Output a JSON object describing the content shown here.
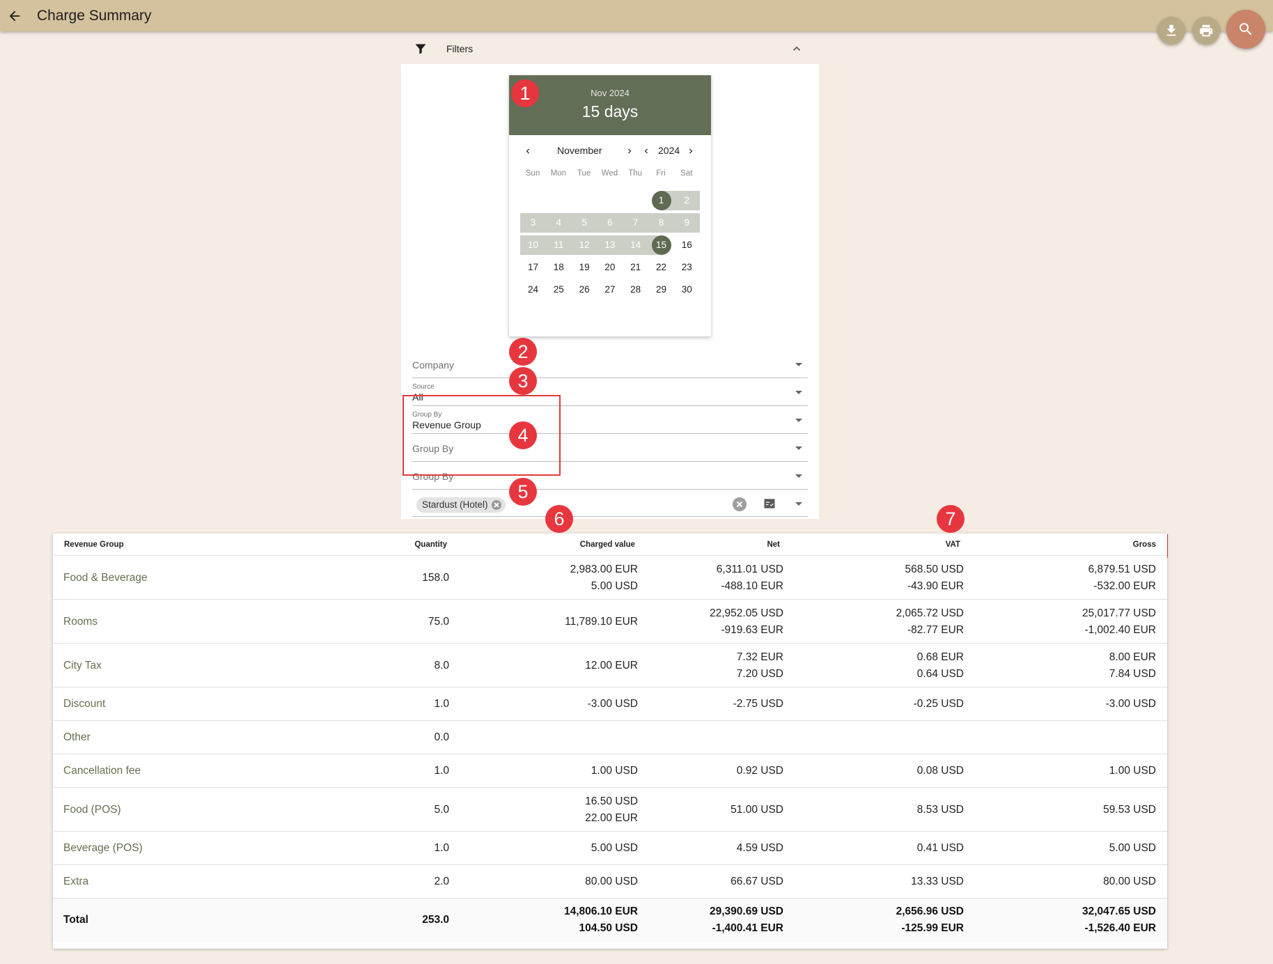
{
  "header": {
    "title": "Charge Summary",
    "icons": [
      "back-arrow-icon",
      "download-icon",
      "print-icon",
      "search-icon"
    ],
    "colors": {
      "bar": "#d3c29d",
      "search_button": "#c9846a",
      "accent": "#636e56"
    }
  },
  "filters": {
    "label": "Filters",
    "date_picker": {
      "header_month": "Nov 2024",
      "header_days": "15 days",
      "month_label": "November",
      "year_label": "2024",
      "weekdays": [
        "Sun",
        "Mon",
        "Tue",
        "Wed",
        "Thu",
        "Fri",
        "Sat"
      ],
      "weeks": [
        [
          "",
          "",
          "",
          "",
          "",
          "1",
          "2"
        ],
        [
          "3",
          "4",
          "5",
          "6",
          "7",
          "8",
          "9"
        ],
        [
          "10",
          "11",
          "12",
          "13",
          "14",
          "15",
          "16"
        ],
        [
          "17",
          "18",
          "19",
          "20",
          "21",
          "22",
          "23"
        ],
        [
          "24",
          "25",
          "26",
          "27",
          "28",
          "29",
          "30"
        ]
      ],
      "range_start": 1,
      "range_end": 15
    },
    "company": {
      "placeholder": "Company"
    },
    "source": {
      "label": "Source",
      "value": "All"
    },
    "group_by_1": {
      "label": "Group By",
      "value": "Revenue Group"
    },
    "group_by_2": {
      "placeholder": "Group By"
    },
    "group_by_3": {
      "placeholder": "Group By"
    },
    "property_chip": "Stardust (Hotel)"
  },
  "annotations": [
    "1",
    "2",
    "3",
    "4",
    "5",
    "6",
    "7"
  ],
  "table": {
    "headers": {
      "group": "Revenue Group",
      "quantity": "Quantity",
      "charged": "Charged value",
      "net": "Net",
      "vat": "VAT",
      "gross": "Gross"
    },
    "rows": [
      {
        "name": "Food & Beverage",
        "quantity": "158.0",
        "charged": [
          "2,983.00 EUR",
          "5.00 USD"
        ],
        "net": [
          "6,311.01 USD",
          "-488.10 EUR"
        ],
        "vat": [
          "568.50 USD",
          "-43.90 EUR"
        ],
        "gross": [
          "6,879.51 USD",
          "-532.00 EUR"
        ]
      },
      {
        "name": "Rooms",
        "quantity": "75.0",
        "charged": [
          "11,789.10 EUR"
        ],
        "net": [
          "22,952.05 USD",
          "-919.63 EUR"
        ],
        "vat": [
          "2,065.72 USD",
          "-82.77 EUR"
        ],
        "gross": [
          "25,017.77 USD",
          "-1,002.40 EUR"
        ]
      },
      {
        "name": "City Tax",
        "quantity": "8.0",
        "charged": [
          "12.00 EUR"
        ],
        "net": [
          "7.32 EUR",
          "7.20 USD"
        ],
        "vat": [
          "0.68 EUR",
          "0.64 USD"
        ],
        "gross": [
          "8.00 EUR",
          "7.84 USD"
        ]
      },
      {
        "name": "Discount",
        "quantity": "1.0",
        "charged": [
          "-3.00 USD"
        ],
        "net": [
          "-2.75 USD"
        ],
        "vat": [
          "-0.25 USD"
        ],
        "gross": [
          "-3.00 USD"
        ]
      },
      {
        "name": "Other",
        "quantity": "0.0",
        "charged": [],
        "net": [],
        "vat": [],
        "gross": []
      },
      {
        "name": "Cancellation fee",
        "quantity": "1.0",
        "charged": [
          "1.00 USD"
        ],
        "net": [
          "0.92 USD"
        ],
        "vat": [
          "0.08 USD"
        ],
        "gross": [
          "1.00 USD"
        ]
      },
      {
        "name": "Food (POS)",
        "quantity": "5.0",
        "charged": [
          "16.50 USD",
          "22.00 EUR"
        ],
        "net": [
          "51.00 USD"
        ],
        "vat": [
          "8.53 USD"
        ],
        "gross": [
          "59.53 USD"
        ]
      },
      {
        "name": "Beverage (POS)",
        "quantity": "1.0",
        "charged": [
          "5.00 USD"
        ],
        "net": [
          "4.59 USD"
        ],
        "vat": [
          "0.41 USD"
        ],
        "gross": [
          "5.00 USD"
        ]
      },
      {
        "name": "Extra",
        "quantity": "2.0",
        "charged": [
          "80.00 USD"
        ],
        "net": [
          "66.67 USD"
        ],
        "vat": [
          "13.33 USD"
        ],
        "gross": [
          "80.00 USD"
        ]
      }
    ],
    "total": {
      "name": "Total",
      "quantity": "253.0",
      "charged": [
        "14,806.10 EUR",
        "104.50 USD"
      ],
      "net": [
        "29,390.69 USD",
        "-1,400.41 EUR"
      ],
      "vat": [
        "2,656.96 USD",
        "-125.99 EUR"
      ],
      "gross": [
        "32,047.65 USD",
        "-1,526.40 EUR"
      ]
    }
  }
}
